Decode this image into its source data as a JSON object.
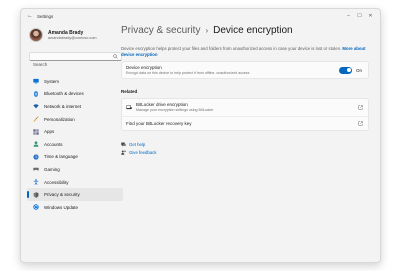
{
  "window": {
    "title": "Settings"
  },
  "titlebar": {
    "minimize": "–",
    "maximize": "☐",
    "close": "✕",
    "back": "←"
  },
  "profile": {
    "name": "Amanda Brady",
    "email": "amandabrady@contoso.com"
  },
  "search": {
    "placeholder": "Search"
  },
  "sidebar": {
    "items": [
      {
        "label": "System",
        "icon": "system-icon",
        "color": "#0067c0"
      },
      {
        "label": "Bluetooth & devices",
        "icon": "bluetooth-icon",
        "color": "#0067c0"
      },
      {
        "label": "Network & internet",
        "icon": "wifi-icon",
        "color": "#1f5fa8"
      },
      {
        "label": "Personalization",
        "icon": "brush-icon",
        "color": "#c77a1a"
      },
      {
        "label": "Apps",
        "icon": "apps-icon",
        "color": "#5a5a7a"
      },
      {
        "label": "Accounts",
        "icon": "person-icon",
        "color": "#2e9a6f"
      },
      {
        "label": "Time & language",
        "icon": "clock-globe-icon",
        "color": "#2a72c9"
      },
      {
        "label": "Gaming",
        "icon": "controller-icon",
        "color": "#6b6b6b"
      },
      {
        "label": "Accessibility",
        "icon": "accessibility-icon",
        "color": "#1a6fd0"
      },
      {
        "label": "Privacy & security",
        "icon": "shield-icon",
        "color": "#6b6b6b"
      },
      {
        "label": "Windows Update",
        "icon": "update-icon",
        "color": "#0a73d9"
      }
    ],
    "active_index": 9
  },
  "header": {
    "parent": "Privacy & security",
    "separator": "›",
    "current": "Device encryption"
  },
  "description": {
    "text": "Device encryption helps protect your files and folders from unauthorized access in case your device is lost or stolen.",
    "link": "More about device encryption"
  },
  "encryption": {
    "title": "Device encryption",
    "subtitle": "Encrypt data on this device to help protect it from offline, unauthorized access",
    "state": "On",
    "enabled": true
  },
  "related": {
    "heading": "Related",
    "items": [
      {
        "title": "BitLocker drive encryption",
        "subtitle": "Manage your encryption settings using BitLocker"
      },
      {
        "title": "Find your BitLocker recovery key"
      }
    ]
  },
  "help": {
    "get_help": "Get help",
    "give_feedback": "Give feedback"
  },
  "colors": {
    "accent": "#0067c0",
    "window_bg": "#f3f3f3",
    "card_bg": "#fbfbfb"
  }
}
